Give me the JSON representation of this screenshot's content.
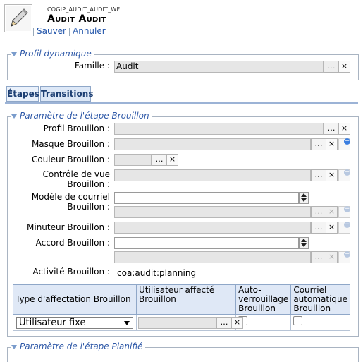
{
  "header": {
    "code": "COGIP_AUDIT_AUDIT_WFL",
    "title": "Audit Audit",
    "save": "Sauver",
    "cancel": "Annuler",
    "icon": "pencil-icon"
  },
  "profil_dyn": {
    "legend": "Profil dynamique",
    "famille_label": "Famille :",
    "famille_value": "Audit"
  },
  "tabs": [
    "Étapes",
    "Transitions"
  ],
  "etape_brouillon": {
    "legend": "Paramètre de l'étape Brouillon",
    "profil": "Profil Brouillon :",
    "masque": "Masque Brouillon :",
    "couleur": "Couleur Brouillon :",
    "controle": "Contrôle de vue Brouillon :",
    "modele": "Modèle de courriel Brouillon :",
    "minuteur": "Minuteur Brouillon :",
    "accord": "Accord Brouillon :",
    "activite": "Activité Brouillon :",
    "activite_value": "coa:audit:planning"
  },
  "affectation": {
    "headers": [
      "Type d'affectation Brouillon",
      "Utilisateur affecté Brouillon",
      "Auto-verrouillage Brouillon",
      "Courriel automatique Brouillon"
    ],
    "type_value": "Utilisateur fixe"
  },
  "etape_planifie": {
    "legend": "Paramètre de l'étape Planifié"
  },
  "glyphs": {
    "browse": "…",
    "clear": "×"
  },
  "colors": {
    "accent": "#2f59a8",
    "input_bg": "#e6e6e6",
    "tab_bg": "#dde8f7"
  }
}
